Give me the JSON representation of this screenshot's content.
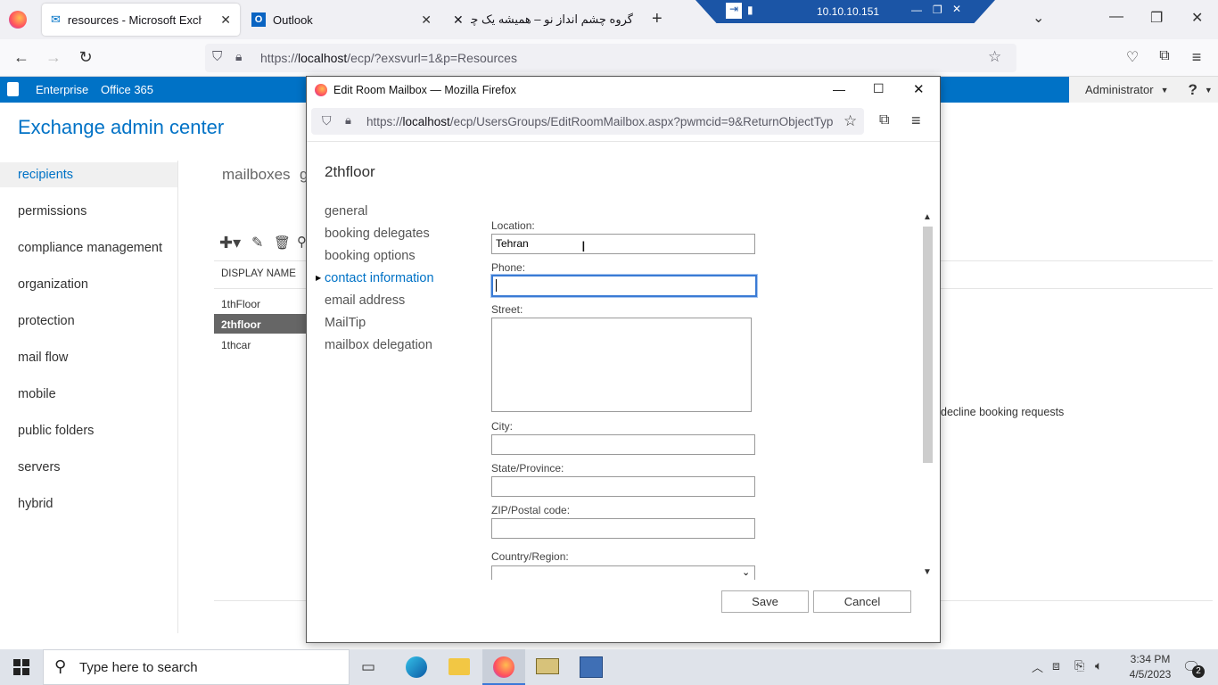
{
  "browser": {
    "tabs": [
      {
        "label": "resources - Microsoft Exchange"
      },
      {
        "label": "Outlook"
      },
      {
        "label": "گروه چشم انداز نو – همیشه یک چشم"
      }
    ],
    "url_prefix": "https://",
    "url_host": "localhost",
    "url_path": "/ecp/?exsvurl=1&p=Resources",
    "remote_ip": "10.10.10.151"
  },
  "exchange": {
    "brand1": "Enterprise",
    "brand2": "Office 365",
    "user": "Administrator",
    "help": "?",
    "title": "Exchange admin center",
    "nav": [
      "recipients",
      "permissions",
      "compliance management",
      "organization",
      "protection",
      "mail flow",
      "mobile",
      "public folders",
      "servers",
      "hybrid"
    ],
    "tab": "mailboxes",
    "tab_partial": "g",
    "list_header": "DISPLAY NAME",
    "rows": [
      "1thFloor",
      "2thfloor",
      "1thcar"
    ],
    "behind_text": "decline booking requests"
  },
  "dialog": {
    "window_title": "Edit Room Mailbox — Mozilla Firefox",
    "url_prefix": "https://",
    "url_host": "localhost",
    "url_path": "/ecp/UsersGroups/EditRoomMailbox.aspx?pwmcid=9&ReturnObjectTyp",
    "heading": "2thfloor",
    "nav": [
      "general",
      "booking delegates",
      "booking options",
      "contact information",
      "email address",
      "MailTip",
      "mailbox delegation"
    ],
    "fields": {
      "location_label": "Location:",
      "location_value": "Tehran",
      "phone_label": "Phone:",
      "phone_value": "",
      "street_label": "Street:",
      "city_label": "City:",
      "state_label": "State/Province:",
      "zip_label": "ZIP/Postal code:",
      "country_label": "Country/Region:"
    },
    "save": "Save",
    "cancel": "Cancel"
  },
  "taskbar": {
    "search_placeholder": "Type here to search",
    "time": "3:34 PM",
    "date": "4/5/2023",
    "notif_count": "2"
  }
}
